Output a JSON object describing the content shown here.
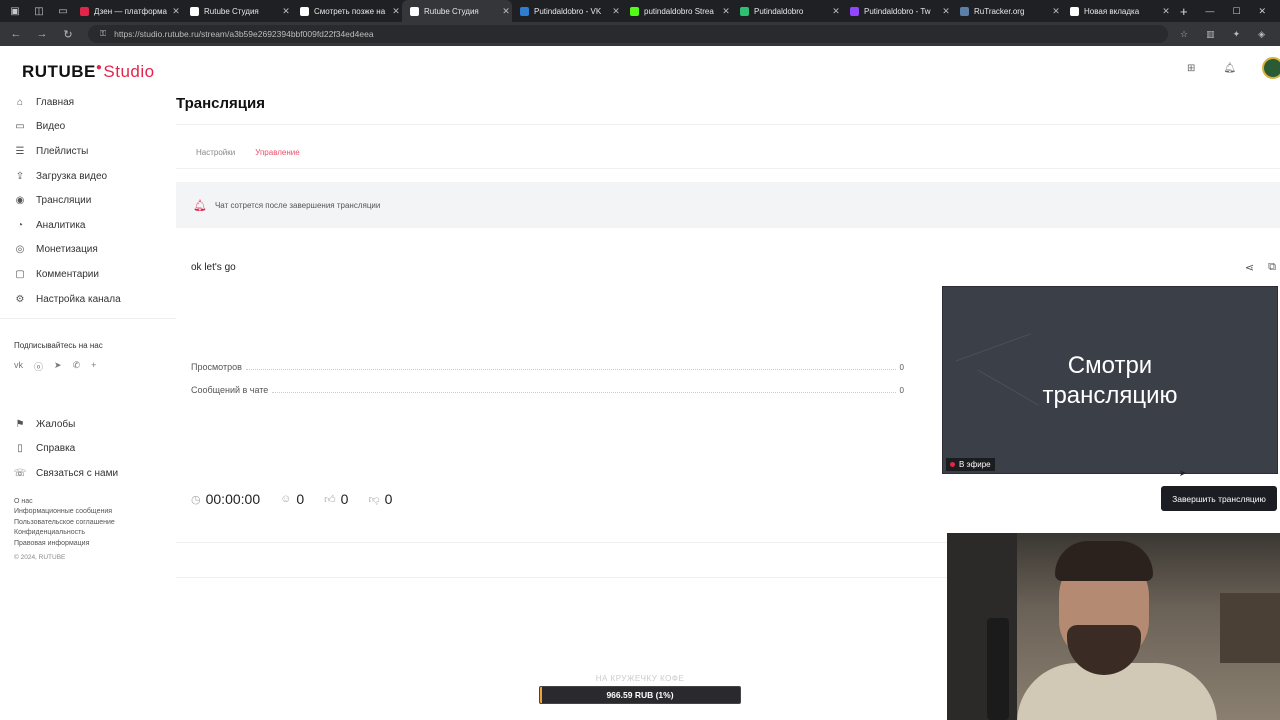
{
  "browser": {
    "tabs": [
      {
        "title": "Дзен — платформа",
        "color": "#e1264a"
      },
      {
        "title": "Rutube Студия",
        "color": "#ffffff"
      },
      {
        "title": "Смотреть позже на",
        "color": "#ffffff"
      },
      {
        "title": "Rutube Студия",
        "color": "#ffffff",
        "active": true
      },
      {
        "title": "Putindaldobro - VK",
        "color": "#2f7dd1"
      },
      {
        "title": "putindaldobro Strea",
        "color": "#53fc18"
      },
      {
        "title": "Putindaldobro",
        "color": "#2fbf71"
      },
      {
        "title": "Putindaldobro - Tw",
        "color": "#9146ff"
      },
      {
        "title": "RuTracker.org",
        "color": "#5b7fa8"
      },
      {
        "title": "Новая вкладка",
        "color": "#ffffff"
      }
    ],
    "url": "https://studio.rutube.ru/stream/a3b59e2692394bbf009fd22f34ed4eea"
  },
  "brand": {
    "name": "RUTUBE",
    "suffix": "Studio",
    "accent": "#e1264a"
  },
  "sidebar": {
    "items": [
      {
        "label": "Главная",
        "icon": "home-icon"
      },
      {
        "label": "Видео",
        "icon": "video-icon"
      },
      {
        "label": "Плейлисты",
        "icon": "playlist-icon"
      },
      {
        "label": "Загрузка видео",
        "icon": "upload-icon"
      },
      {
        "label": "Трансляции",
        "icon": "broadcast-icon"
      },
      {
        "label": "Аналитика",
        "icon": "analytics-icon"
      },
      {
        "label": "Монетизация",
        "icon": "monetization-icon"
      },
      {
        "label": "Комментарии",
        "icon": "comments-icon"
      },
      {
        "label": "Настройка канала",
        "icon": "settings-icon"
      }
    ],
    "follow_label": "Подписывайтесь на нас",
    "secondary": [
      {
        "label": "Жалобы",
        "icon": "flag-icon"
      },
      {
        "label": "Справка",
        "icon": "help-icon"
      },
      {
        "label": "Связаться с нами",
        "icon": "contact-icon"
      }
    ],
    "footer_links": [
      "О нас",
      "Информационные сообщения",
      "Пользовательское соглашение",
      "Конфиденциальность",
      "Правовая информация"
    ],
    "copyright": "© 2024, RUTUBE"
  },
  "page": {
    "title": "Трансляция",
    "tabs": {
      "settings": "Настройки",
      "control": "Управление"
    },
    "notice": "Чат сотрется после завершения трансляции",
    "stream_title": "ok let's go",
    "stats": [
      {
        "label": "Просмотров",
        "value": "0"
      },
      {
        "label": "Сообщений в чате",
        "value": "0"
      }
    ],
    "counters": {
      "time": "00:00:00",
      "viewers": "0",
      "likes": "0",
      "dislikes": "0"
    },
    "preview": {
      "line1": "Смотри",
      "line2": "трансляцию",
      "live_label": "В эфире"
    },
    "end_button": "Завершить трансляцию"
  },
  "overlay": {
    "donation_label": "НА КРУЖЕЧКУ КОФЕ",
    "donation_text": "966.59 RUB (1%)",
    "donation_progress": 0.01
  }
}
